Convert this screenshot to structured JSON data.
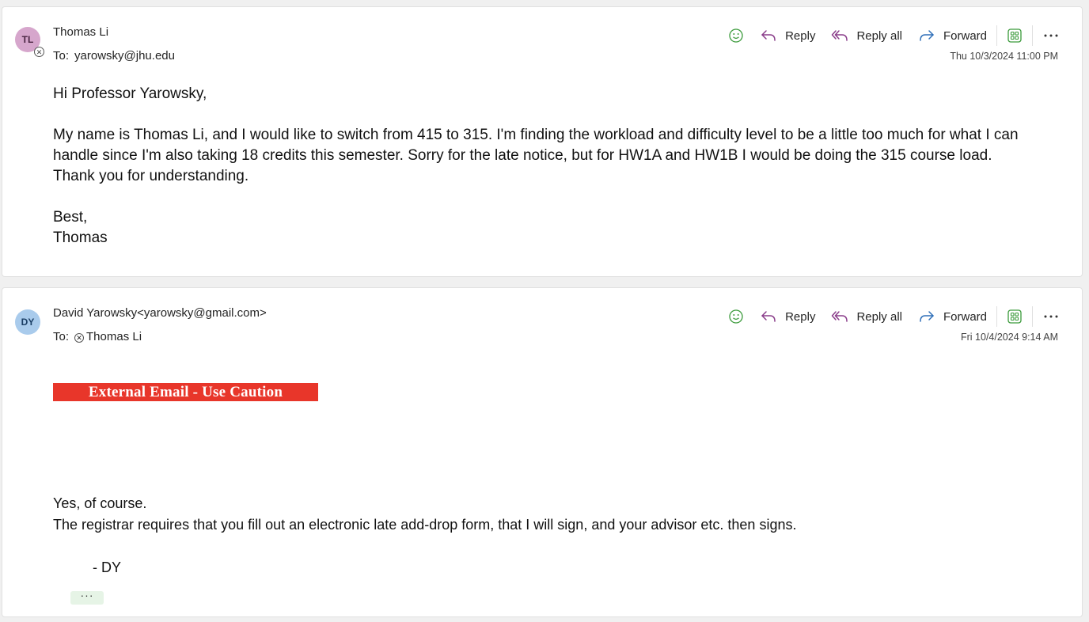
{
  "actions": {
    "reply_label": "Reply",
    "reply_all_label": "Reply all",
    "forward_label": "Forward"
  },
  "messages": [
    {
      "avatar_initials": "TL",
      "avatar_color": "#d6a6cc",
      "sender": "Thomas Li",
      "to_label": "To:",
      "to": "yarowsky@jhu.edu",
      "timestamp": "Thu 10/3/2024 11:00 PM",
      "body": {
        "greeting": "Hi Professor Yarowsky,",
        "paragraph": "My name is Thomas Li, and I would like to switch from 415 to 315. I'm finding the workload and difficulty level to be a little too much for what I can handle since I'm also taking 18 credits this semester. Sorry for the late notice, but for HW1A and HW1B I would be doing the 315 course load. Thank you for understanding.",
        "closing": "Best,",
        "signature": "Thomas"
      }
    },
    {
      "avatar_initials": "DY",
      "avatar_color": "#a9cbec",
      "sender": "David Yarowsky<yarowsky@gmail.com>",
      "to_label": "To:",
      "to": "Thomas Li",
      "timestamp": "Fri 10/4/2024 9:14 AM",
      "caution_banner": "External Email - Use Caution",
      "caution_color": "#e8362a",
      "body": {
        "line1": "Yes, of course.",
        "line2": "The registrar requires that you fill out an electronic late add-drop form, that I will sign, and your advisor etc. then signs.",
        "signature": "- DY"
      },
      "show_trimmed_label": "···"
    }
  ],
  "icons": {
    "emoji": "smiley-icon",
    "reply": "reply-arrow-icon",
    "reply_all": "reply-all-arrow-icon",
    "forward": "forward-arrow-icon",
    "apps": "apps-grid-icon",
    "more": "more-horizontal-icon"
  }
}
